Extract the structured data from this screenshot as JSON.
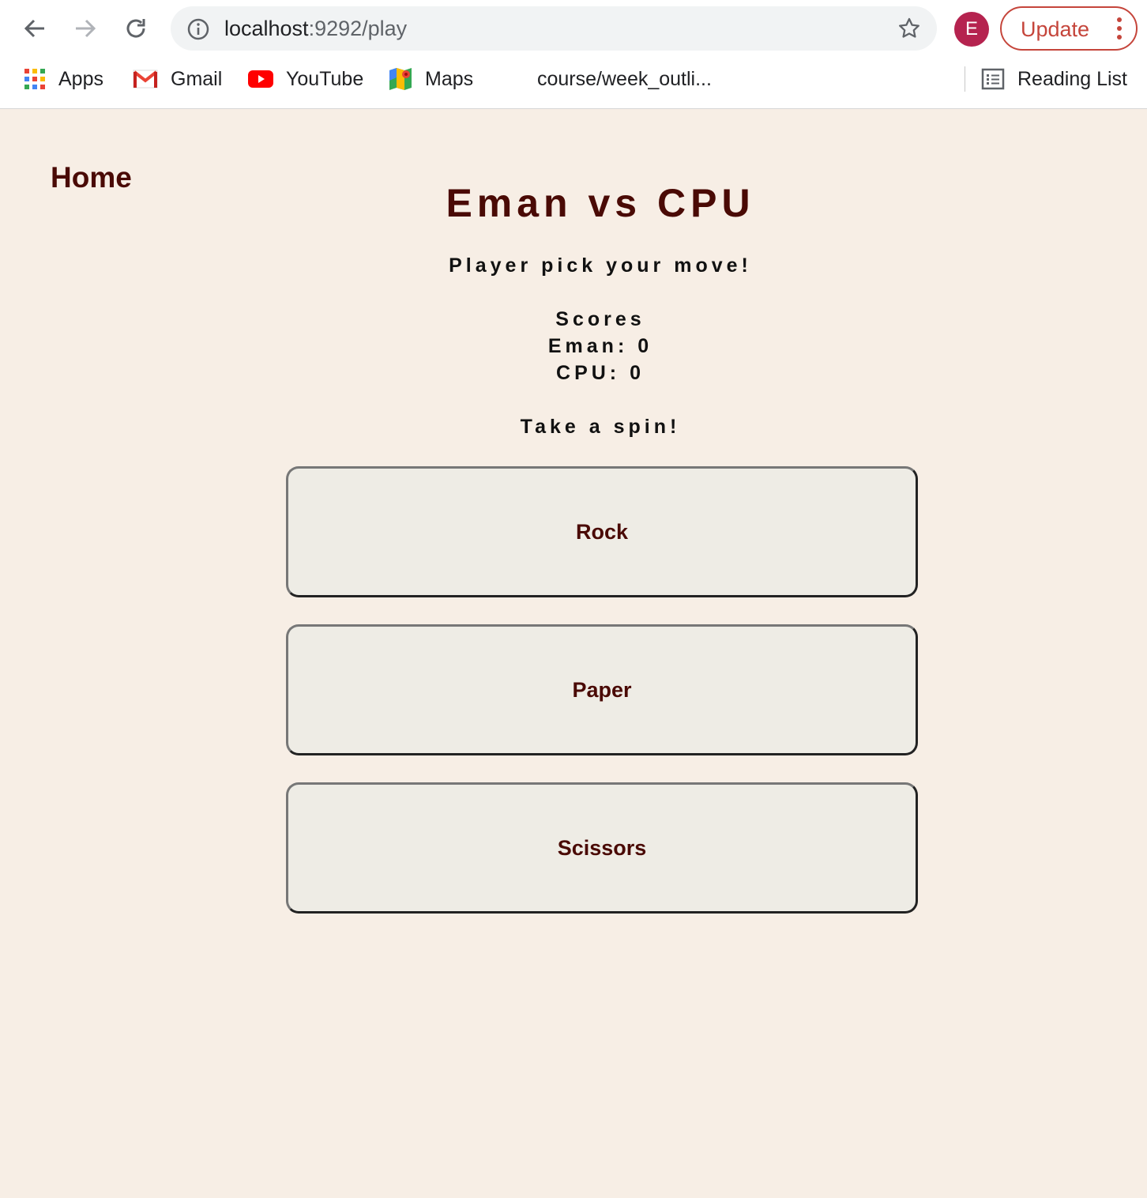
{
  "browser": {
    "url_host": "localhost",
    "url_rest": ":9292/play",
    "profile_initial": "E",
    "update_label": "Update",
    "bookmarks": [
      {
        "label": "Apps",
        "icon": "apps-grid-icon"
      },
      {
        "label": "Gmail",
        "icon": "gmail-icon"
      },
      {
        "label": "YouTube",
        "icon": "youtube-icon"
      },
      {
        "label": "Maps",
        "icon": "maps-icon"
      },
      {
        "label": "course/week_outli..."
      }
    ],
    "reading_list_label": "Reading List"
  },
  "page": {
    "home_link": "Home",
    "title": "Eman vs CPU",
    "prompt": "Player pick your move!",
    "scores_heading": "Scores",
    "player_score": "Eman: 0",
    "cpu_score": "CPU: 0",
    "spin_text": "Take a spin!",
    "moves": [
      "Rock",
      "Paper",
      "Scissors"
    ]
  },
  "colors": {
    "background": "#f7eee5",
    "accent": "#4a0a05",
    "button_bg": "#eeece5",
    "update": "#c5453b",
    "avatar": "#b5234f"
  }
}
